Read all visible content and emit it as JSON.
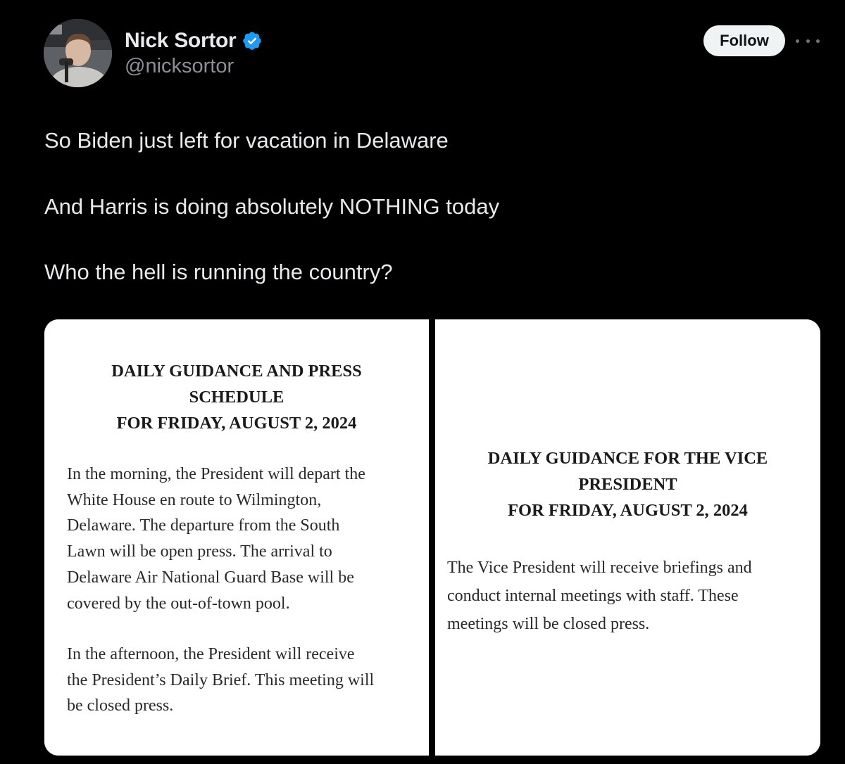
{
  "tweet": {
    "author": {
      "display_name": "Nick Sortor",
      "handle": "@nicksortor",
      "verified": true,
      "verified_color": "#1d9bf0"
    },
    "follow_label": "Follow",
    "more_icon": "more-horizontal-icon",
    "text_lines": [
      "So Biden just left for vacation in Delaware",
      "And Harris is doing absolutely NOTHING today",
      "Who the hell is running the country?"
    ]
  },
  "media": {
    "left_doc": {
      "title_lines": [
        "DAILY GUIDANCE AND PRESS",
        "SCHEDULE",
        "FOR FRIDAY, AUGUST 2, 2024"
      ],
      "paragraph1_lines": [
        "In the morning, the President will depart the",
        "White House en route to Wilmington,",
        "Delaware. The departure from the South",
        "Lawn will be open press. The arrival to",
        "Delaware Air National Guard Base will be",
        "covered by the out-of-town pool."
      ],
      "paragraph2_lines": [
        "In the afternoon, the President will receive",
        "the President’s Daily Brief. This meeting will",
        "be closed press."
      ]
    },
    "right_doc": {
      "title_lines": [
        "DAILY GUIDANCE FOR THE VICE",
        "PRESIDENT",
        "FOR FRIDAY, AUGUST 2, 2024"
      ],
      "paragraph1_lines": [
        "The Vice President will receive briefings and",
        "conduct internal meetings with staff. These",
        "meetings will be closed press."
      ]
    }
  },
  "colors": {
    "background": "#000000",
    "text_primary": "#e7e9ea",
    "text_secondary": "#8b9096",
    "follow_bg": "#eff3f4"
  }
}
